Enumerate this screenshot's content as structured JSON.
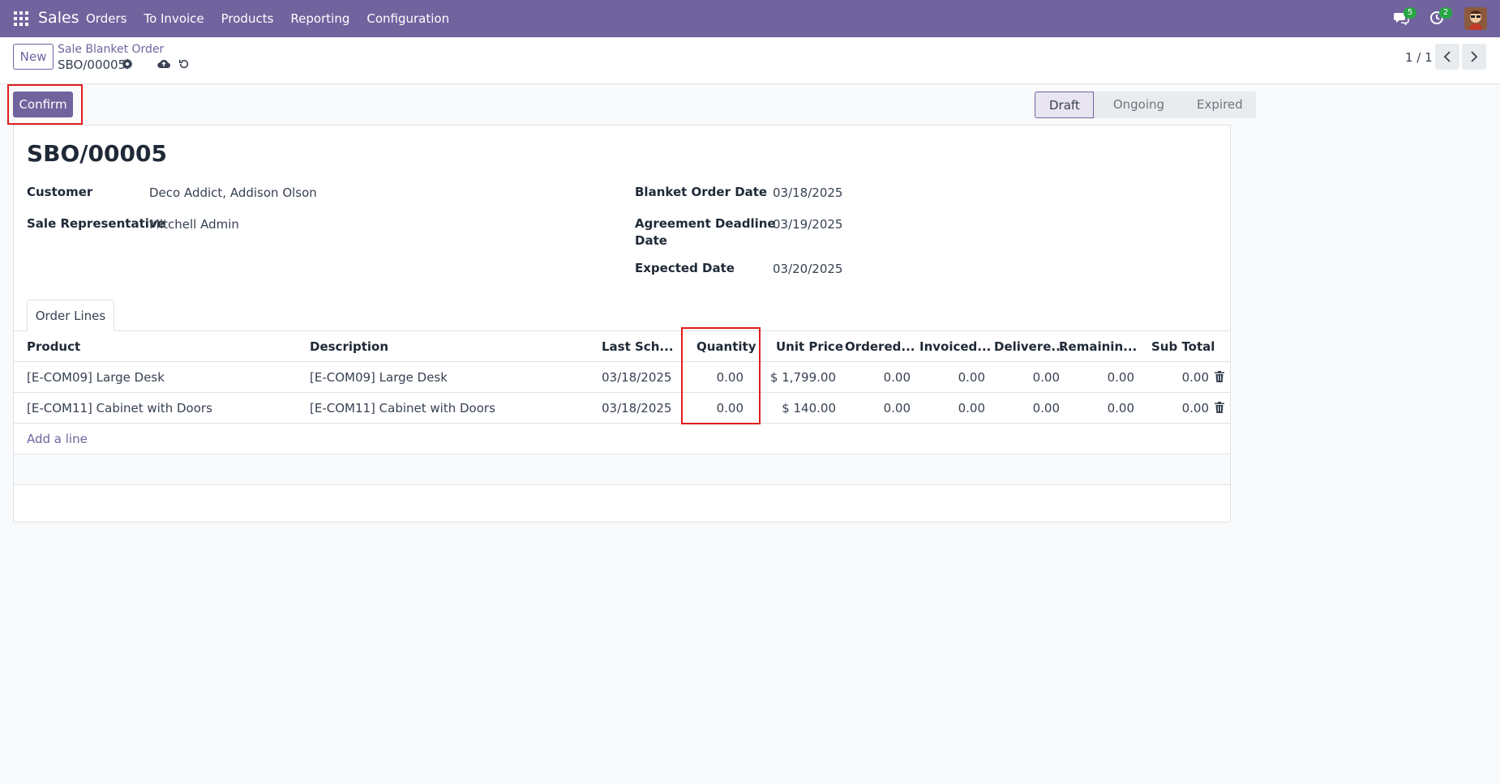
{
  "navbar": {
    "brand": "Sales",
    "menu": [
      "Orders",
      "To Invoice",
      "Products",
      "Reporting",
      "Configuration"
    ],
    "messages_count": "5",
    "activities_count": "2"
  },
  "control_panel": {
    "new_label": "New",
    "breadcrumb_parent": "Sale Blanket Order",
    "record_name": "SBO/00005",
    "pager": "1 / 1"
  },
  "actions": {
    "confirm_label": "Confirm"
  },
  "statusbar": {
    "steps": [
      "Draft",
      "Ongoing",
      "Expired"
    ],
    "active": "Draft"
  },
  "form": {
    "title": "SBO/00005",
    "customer_label": "Customer",
    "customer_value": "Deco Addict, Addison Olson",
    "salesrep_label": "Sale Representative",
    "salesrep_value": "Mitchell Admin",
    "order_date_label": "Blanket Order Date",
    "order_date_value": "03/18/2025",
    "deadline_label_line1": "Agreement Deadline",
    "deadline_label_line2": "Date",
    "deadline_value": "03/19/2025",
    "expected_label": "Expected Date",
    "expected_value": "03/20/2025"
  },
  "tabs": {
    "order_lines": "Order Lines"
  },
  "table": {
    "headers": [
      "Product",
      "Description",
      "Last Sch...",
      "Quantity",
      "Unit Price",
      "Ordered...",
      "Invoiced...",
      "Delivere...",
      "Remainin...",
      "Sub Total"
    ],
    "rows": [
      [
        "[E-COM09] Large Desk",
        "[E-COM09] Large Desk",
        "03/18/2025",
        "0.00",
        "$ 1,799.00",
        "0.00",
        "0.00",
        "0.00",
        "0.00",
        "0.00"
      ],
      [
        "[E-COM11] Cabinet with Doors",
        "[E-COM11] Cabinet with Doors",
        "03/18/2025",
        "0.00",
        "$ 140.00",
        "0.00",
        "0.00",
        "0.00",
        "0.00",
        "0.00"
      ]
    ],
    "add_line": "Add a line"
  },
  "colors": {
    "brand": "#71639e",
    "highlight": "#e11d1d",
    "badge": "#28a745"
  }
}
